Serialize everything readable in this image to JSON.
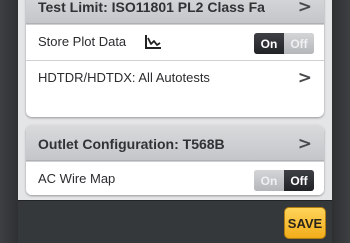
{
  "test_limit": {
    "title": "Test Limit: ISO11801 PL2 Class Fa",
    "chevron": ">"
  },
  "store_plot_data": {
    "label": "Store Plot Data",
    "icon": "plot-graph-icon",
    "toggle": {
      "on_label": "On",
      "off_label": "Off",
      "state": "on"
    }
  },
  "hdtdr": {
    "label": "HDTDR/HDTDX: All Autotests",
    "chevron": ">"
  },
  "outlet_configuration": {
    "title": "Outlet Configuration: T568B",
    "chevron": ">"
  },
  "ac_wire_map": {
    "label": "AC Wire Map",
    "toggle": {
      "on_label": "On",
      "off_label": "Off",
      "state": "off"
    }
  },
  "footer": {
    "save_label": "SAVE"
  },
  "colors": {
    "save_button": "#f5b324",
    "toggle_active": "#2b2d31",
    "header_bg": "#cdced1",
    "screen_bg": "#e4e5e7"
  }
}
